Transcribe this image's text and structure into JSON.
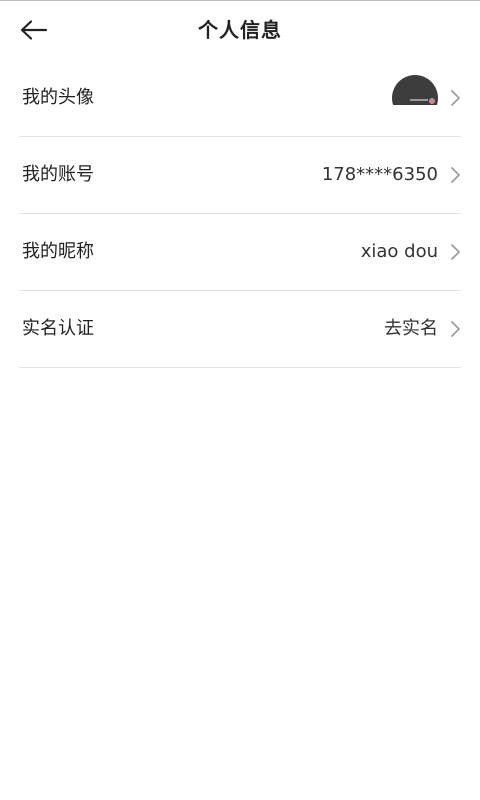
{
  "header": {
    "title": "个人信息",
    "back_icon": "arrow-left-icon"
  },
  "rows": [
    {
      "label": "我的头像",
      "value": "",
      "type": "avatar"
    },
    {
      "label": "我的账号",
      "value": "178****6350"
    },
    {
      "label": "我的昵称",
      "value": "xiao dou"
    },
    {
      "label": "实名认证",
      "value": "去实名"
    }
  ],
  "colors": {
    "text": "#222222",
    "divider": "#e3e3e3",
    "chevron": "#9e9e9e"
  }
}
